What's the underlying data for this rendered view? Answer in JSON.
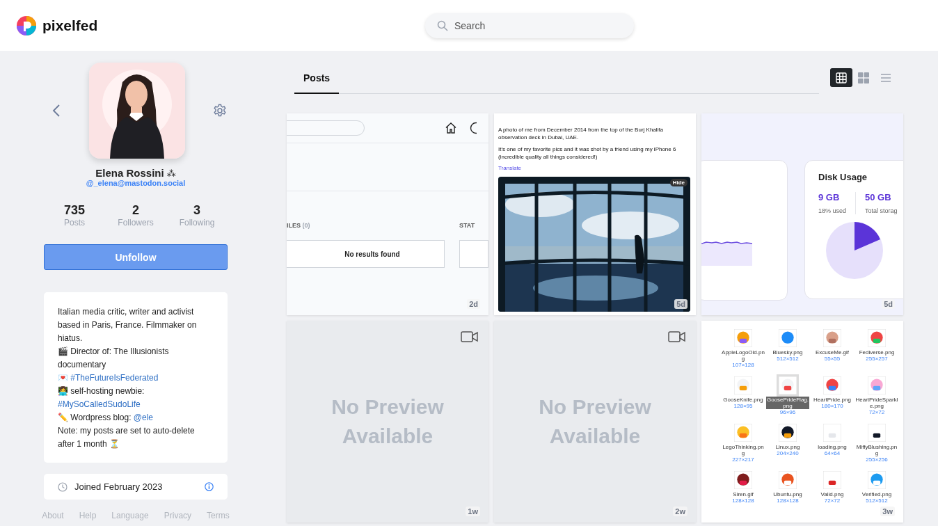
{
  "brand": {
    "name": "pixelfed"
  },
  "search": {
    "placeholder": "Search"
  },
  "profile": {
    "name": "Elena Rossini",
    "name_mark": "⁂",
    "handle": "@_elena@mastodon.social",
    "stats": [
      {
        "value": "735",
        "label": "Posts"
      },
      {
        "value": "2",
        "label": "Followers"
      },
      {
        "value": "3",
        "label": "Following"
      }
    ],
    "action": "Unfollow",
    "bio": [
      [
        {
          "text": "Italian media critic, writer and activist based in Paris, France. Filmmaker on hiatus."
        }
      ],
      [
        {
          "text": "🎬 Director of: The Illusionists documentary"
        }
      ],
      [
        {
          "text": "💌 "
        },
        {
          "text": "#TheFutureIsFederated",
          "link": true
        }
      ],
      [
        {
          "text": "👩‍💻 self-hosting newbie: "
        },
        {
          "text": "#MySoCalledSudoLife",
          "link": true
        }
      ],
      [
        {
          "text": "✏️ Wordpress blog: "
        },
        {
          "text": "@ele",
          "link": true
        }
      ],
      [
        {
          "text": "Note: my posts are set to auto-delete after 1 month ⏳"
        }
      ]
    ],
    "joined": "Joined February 2023"
  },
  "footer_links": [
    "About",
    "Help",
    "Language",
    "Privacy",
    "Terms"
  ],
  "tabs": [
    {
      "label": "Posts",
      "selected": true
    }
  ],
  "layouts": [
    {
      "kind": "grid",
      "selected": true
    },
    {
      "kind": "tiles",
      "selected": false
    },
    {
      "kind": "list",
      "selected": false
    }
  ],
  "posts": [
    {
      "kind": "search_screenshot",
      "age": "2d",
      "section": "ILES",
      "count": "(0)",
      "section_2": "STAT",
      "empty": "No results found"
    },
    {
      "kind": "text_photo",
      "age": "5d",
      "paragraphs": [
        "A photo of me from December 2014 from the top of the Burj Khalifa observation deck in Dubai, UAE.",
        "It's one of my favorite pics and it was shot by a friend using my iPhone 6 (incredible quality all things considered!)"
      ],
      "link": "Translate",
      "badge": "Hide"
    },
    {
      "kind": "dashboard",
      "age": "5d",
      "title": "Disk Usage",
      "figures": [
        {
          "value": "9 GB",
          "label": "18% used"
        },
        {
          "value": "50 GB",
          "label": "Total storag"
        }
      ]
    },
    {
      "kind": "video",
      "age": "1w",
      "message": "No Preview Available"
    },
    {
      "kind": "video",
      "age": "2w",
      "message": "No Preview Available"
    },
    {
      "kind": "file_grid",
      "age": "3w",
      "files": [
        {
          "name": "AppleLogoOld.png",
          "size": "107×128",
          "selected": false
        },
        {
          "name": "Bluesky.png",
          "size": "512×512",
          "selected": false
        },
        {
          "name": "ExcuseMe.gif",
          "size": "55×55",
          "selected": false
        },
        {
          "name": "Fediverse.png",
          "size": "255×257",
          "selected": false
        },
        {
          "name": "GooseKnife.png",
          "size": "128×95",
          "selected": false
        },
        {
          "name": "GoosePrideFlag.png",
          "size": "96×96",
          "selected": true
        },
        {
          "name": "HeartPride.png",
          "size": "180×170",
          "selected": false
        },
        {
          "name": "HeartPrideSparkle.png",
          "size": "72×72",
          "selected": false
        },
        {
          "name": "LegoThinking.png",
          "size": "227×217",
          "selected": false
        },
        {
          "name": "Linux.png",
          "size": "204×240",
          "selected": false
        },
        {
          "name": "loading.png",
          "size": "64×64",
          "selected": false
        },
        {
          "name": "MiffyBlushing.png",
          "size": "255×256",
          "selected": false
        },
        {
          "name": "Siren.gif",
          "size": "128×128",
          "selected": false
        },
        {
          "name": "Ubuntu.png",
          "size": "128×128",
          "selected": false
        },
        {
          "name": "Valid.png",
          "size": "72×72",
          "selected": false
        },
        {
          "name": "Verified.png",
          "size": "512×512",
          "selected": false
        }
      ]
    }
  ]
}
